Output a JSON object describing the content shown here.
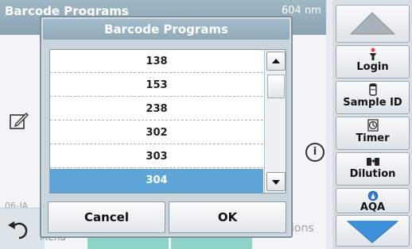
{
  "background": {
    "title": "Barcode Programs",
    "wavelength": "604 nm",
    "date": "06-JA",
    "menu_label": "Menu",
    "options_fragment": "ions"
  },
  "sidebar": {
    "tools": [
      {
        "label": "Login",
        "icon": "person-icon"
      },
      {
        "label": "Sample ID",
        "icon": "sample-vial-icon"
      },
      {
        "label": "Timer",
        "icon": "timer-icon"
      },
      {
        "label": "Dilution",
        "icon": "dilution-icon"
      },
      {
        "label": "AQA",
        "icon": "aqa-icon"
      }
    ]
  },
  "dialog": {
    "title": "Barcode Programs",
    "items": [
      "138",
      "153",
      "238",
      "302",
      "303",
      "304"
    ],
    "selected": "304",
    "cancel_label": "Cancel",
    "ok_label": "OK"
  },
  "colors": {
    "selection": "#5fa6d8",
    "header": "#8fa9b9",
    "nav_arrow": "#3d8fd9"
  }
}
